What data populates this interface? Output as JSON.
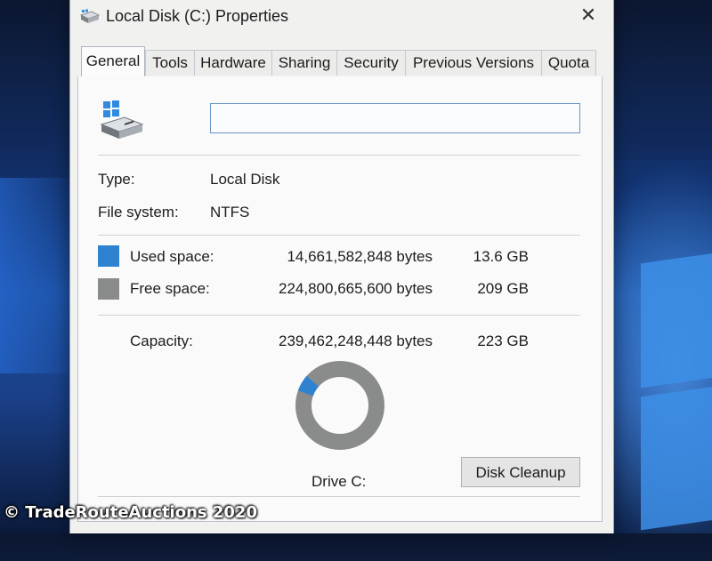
{
  "window": {
    "title": "Local Disk (C:) Properties",
    "close_symbol": "✕",
    "icon": "drive-icon"
  },
  "tabs": [
    {
      "label": "General",
      "active": true
    },
    {
      "label": "Tools",
      "active": false
    },
    {
      "label": "Hardware",
      "active": false
    },
    {
      "label": "Sharing",
      "active": false
    },
    {
      "label": "Security",
      "active": false
    },
    {
      "label": "Previous Versions",
      "active": false
    },
    {
      "label": "Quota",
      "active": false
    }
  ],
  "general": {
    "drive_label_value": "",
    "type_label": "Type:",
    "type_value": "Local Disk",
    "filesystem_label": "File system:",
    "filesystem_value": "NTFS",
    "used": {
      "label": "Used space:",
      "bytes": "14,661,582,848 bytes",
      "size": "13.6 GB",
      "color": "#2f82d0"
    },
    "free": {
      "label": "Free space:",
      "bytes": "224,800,665,600 bytes",
      "size": "209 GB",
      "color": "#8a8c8c"
    },
    "capacity": {
      "label": "Capacity:",
      "bytes": "239,462,248,448 bytes",
      "size": "223 GB"
    },
    "drive_caption": "Drive C:",
    "cleanup_button": "Disk Cleanup",
    "used_fraction": 0.0612
  },
  "watermark": "© TradeRouteAuctions 2020"
}
